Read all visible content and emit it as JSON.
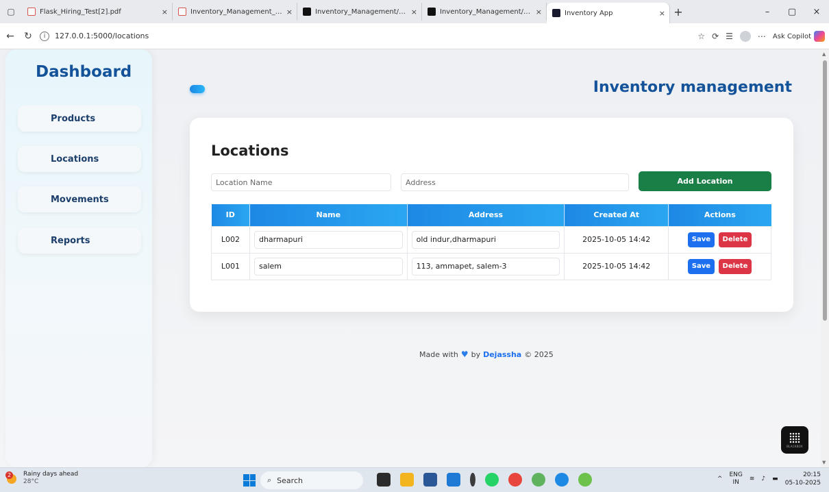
{
  "browser": {
    "tabs": [
      {
        "label": "Flask_Hiring_Test[2].pdf",
        "icon": "pdf-icon",
        "active": false
      },
      {
        "label": "Inventory_Management_System_",
        "icon": "pdf-icon",
        "active": false
      },
      {
        "label": "Inventory_Management/README",
        "icon": "github-icon",
        "active": false
      },
      {
        "label": "Inventory_Management/README",
        "icon": "github-icon",
        "active": false
      },
      {
        "label": "Inventory App",
        "icon": "app-icon",
        "active": true
      }
    ],
    "url": "127.0.0.1:5000/locations",
    "copilot_label": "Ask Copilot",
    "new_tab_glyph": "+",
    "close_glyph": "×",
    "minimize_glyph": "–",
    "restore_glyph": "▢"
  },
  "sidebar": {
    "title": "Dashboard",
    "items": [
      {
        "label": "Products"
      },
      {
        "label": "Locations"
      },
      {
        "label": "Movements"
      },
      {
        "label": "Reports"
      }
    ]
  },
  "header": {
    "title": "Inventory management"
  },
  "locations": {
    "heading": "Locations",
    "name_placeholder": "Location Name",
    "address_placeholder": "Address",
    "add_button": "Add Location",
    "columns": [
      "ID",
      "Name",
      "Address",
      "Created At",
      "Actions"
    ],
    "rows": [
      {
        "id": "L002",
        "name": "dharmapuri",
        "address": "old indur,dharmapuri",
        "created_at": "2025-10-05 14:42"
      },
      {
        "id": "L001",
        "name": "salem",
        "address": "113, ammapet, salem-3",
        "created_at": "2025-10-05 14:42"
      }
    ],
    "save_label": "Save",
    "delete_label": "Delete"
  },
  "footer": {
    "prefix": "Made with",
    "by": "by",
    "author": "Dejassha",
    "suffix": "© 2025"
  },
  "blackbox": {
    "label": "BLACKBOX"
  },
  "taskbar": {
    "weather_text": "Rainy days ahead",
    "temperature": "28°C",
    "weather_badge": "2",
    "search_placeholder": "Search",
    "lang_top": "ENG",
    "lang_bottom": "IN",
    "time": "20:15",
    "date": "05-10-2025"
  },
  "colors": {
    "brand_blue": "#14539a",
    "add_green": "#1a7f46",
    "save_blue": "#1e6ff0",
    "delete_red": "#dc3545",
    "table_header": "#1e88e5"
  }
}
